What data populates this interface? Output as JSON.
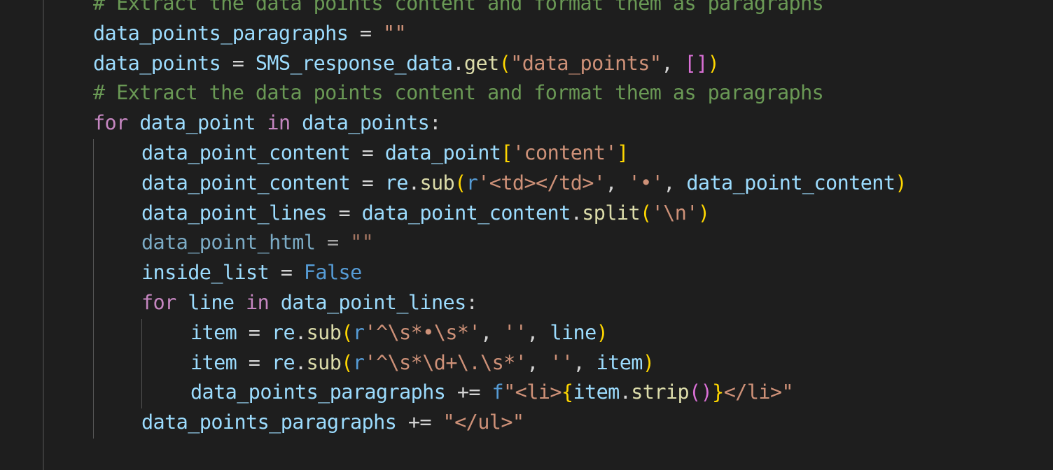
{
  "editor": {
    "language": "python",
    "colors": {
      "background": "#1e1e1e",
      "variable": "#9cdcfe",
      "keyword": "#c586c0",
      "constant": "#569cd6",
      "string": "#ce9178",
      "comment": "#6a9955",
      "bracket": "#ffd700"
    },
    "lines": [
      {
        "indent": 0,
        "tokens": [
          {
            "t": "# Extract the data points content and format them as paragraphs",
            "c": "cmt"
          }
        ]
      },
      {
        "indent": 0,
        "tokens": [
          {
            "t": "data_points_paragraphs",
            "c": "var"
          },
          {
            "t": " = ",
            "c": "op"
          },
          {
            "t": "\"\"",
            "c": "str"
          }
        ]
      },
      {
        "indent": 0,
        "tokens": [
          {
            "t": "data_points",
            "c": "var"
          },
          {
            "t": " = ",
            "c": "op"
          },
          {
            "t": "SMS_response_data",
            "c": "var"
          },
          {
            "t": ".",
            "c": "punc"
          },
          {
            "t": "get",
            "c": "fn"
          },
          {
            "t": "(",
            "c": "br1"
          },
          {
            "t": "\"data_points\"",
            "c": "str"
          },
          {
            "t": ", ",
            "c": "punc"
          },
          {
            "t": "[]",
            "c": "br2"
          },
          {
            "t": ")",
            "c": "br1"
          }
        ]
      },
      {
        "indent": 0,
        "tokens": [
          {
            "t": "# Extract the data points content and format them as paragraphs",
            "c": "cmt"
          }
        ]
      },
      {
        "indent": 0,
        "tokens": [
          {
            "t": "for",
            "c": "kw"
          },
          {
            "t": " data_point ",
            "c": "var"
          },
          {
            "t": "in",
            "c": "kw"
          },
          {
            "t": " data_points",
            "c": "var"
          },
          {
            "t": ":",
            "c": "punc"
          }
        ]
      },
      {
        "indent": 1,
        "tokens": [
          {
            "t": "data_point_content",
            "c": "var"
          },
          {
            "t": " = ",
            "c": "op"
          },
          {
            "t": "data_point",
            "c": "var"
          },
          {
            "t": "[",
            "c": "br1"
          },
          {
            "t": "'content'",
            "c": "str"
          },
          {
            "t": "]",
            "c": "br1"
          }
        ]
      },
      {
        "indent": 1,
        "tokens": [
          {
            "t": "data_point_content",
            "c": "var"
          },
          {
            "t": " = ",
            "c": "op"
          },
          {
            "t": "re",
            "c": "var"
          },
          {
            "t": ".",
            "c": "punc"
          },
          {
            "t": "sub",
            "c": "fn"
          },
          {
            "t": "(",
            "c": "br1"
          },
          {
            "t": "r",
            "c": "const"
          },
          {
            "t": "'<td></td>'",
            "c": "str"
          },
          {
            "t": ", ",
            "c": "punc"
          },
          {
            "t": "'•'",
            "c": "str"
          },
          {
            "t": ", ",
            "c": "punc"
          },
          {
            "t": "data_point_content",
            "c": "var"
          },
          {
            "t": ")",
            "c": "br1"
          }
        ]
      },
      {
        "indent": 1,
        "tokens": [
          {
            "t": "data_point_lines",
            "c": "var"
          },
          {
            "t": " = ",
            "c": "op"
          },
          {
            "t": "data_point_content",
            "c": "var"
          },
          {
            "t": ".",
            "c": "punc"
          },
          {
            "t": "split",
            "c": "fn"
          },
          {
            "t": "(",
            "c": "br1"
          },
          {
            "t": "'\\n'",
            "c": "str"
          },
          {
            "t": ")",
            "c": "br1"
          }
        ]
      },
      {
        "indent": 1,
        "dim": true,
        "tokens": [
          {
            "t": "data_point_html",
            "c": "var"
          },
          {
            "t": " = ",
            "c": "op"
          },
          {
            "t": "\"\"",
            "c": "str"
          }
        ]
      },
      {
        "indent": 1,
        "tokens": [
          {
            "t": "inside_list",
            "c": "var"
          },
          {
            "t": " = ",
            "c": "op"
          },
          {
            "t": "False",
            "c": "const"
          }
        ]
      },
      {
        "indent": 1,
        "tokens": [
          {
            "t": "for",
            "c": "kw"
          },
          {
            "t": " line ",
            "c": "var"
          },
          {
            "t": "in",
            "c": "kw"
          },
          {
            "t": " data_point_lines",
            "c": "var"
          },
          {
            "t": ":",
            "c": "punc"
          }
        ]
      },
      {
        "indent": 2,
        "tokens": [
          {
            "t": "item",
            "c": "var"
          },
          {
            "t": " = ",
            "c": "op"
          },
          {
            "t": "re",
            "c": "var"
          },
          {
            "t": ".",
            "c": "punc"
          },
          {
            "t": "sub",
            "c": "fn"
          },
          {
            "t": "(",
            "c": "br1"
          },
          {
            "t": "r",
            "c": "const"
          },
          {
            "t": "'^\\s*•\\s*'",
            "c": "str"
          },
          {
            "t": ", ",
            "c": "punc"
          },
          {
            "t": "''",
            "c": "str"
          },
          {
            "t": ", ",
            "c": "punc"
          },
          {
            "t": "line",
            "c": "var"
          },
          {
            "t": ")",
            "c": "br1"
          }
        ]
      },
      {
        "indent": 2,
        "tokens": [
          {
            "t": "item",
            "c": "var"
          },
          {
            "t": " = ",
            "c": "op"
          },
          {
            "t": "re",
            "c": "var"
          },
          {
            "t": ".",
            "c": "punc"
          },
          {
            "t": "sub",
            "c": "fn"
          },
          {
            "t": "(",
            "c": "br1"
          },
          {
            "t": "r",
            "c": "const"
          },
          {
            "t": "'^\\s*\\d+\\.\\s*'",
            "c": "str"
          },
          {
            "t": ", ",
            "c": "punc"
          },
          {
            "t": "''",
            "c": "str"
          },
          {
            "t": ", ",
            "c": "punc"
          },
          {
            "t": "item",
            "c": "var"
          },
          {
            "t": ")",
            "c": "br1"
          }
        ]
      },
      {
        "indent": 2,
        "tokens": [
          {
            "t": "data_points_paragraphs",
            "c": "var"
          },
          {
            "t": " += ",
            "c": "op"
          },
          {
            "t": "f",
            "c": "const"
          },
          {
            "t": "\"<li>",
            "c": "str"
          },
          {
            "t": "{",
            "c": "br1"
          },
          {
            "t": "item",
            "c": "var"
          },
          {
            "t": ".",
            "c": "punc"
          },
          {
            "t": "strip",
            "c": "fn"
          },
          {
            "t": "()",
            "c": "br2"
          },
          {
            "t": "}",
            "c": "br1"
          },
          {
            "t": "</li>\"",
            "c": "str"
          }
        ]
      },
      {
        "indent": 1,
        "tokens": [
          {
            "t": "data_points_paragraphs",
            "c": "var"
          },
          {
            "t": " += ",
            "c": "op"
          },
          {
            "t": "\"</ul>\"",
            "c": "str"
          }
        ]
      }
    ]
  }
}
